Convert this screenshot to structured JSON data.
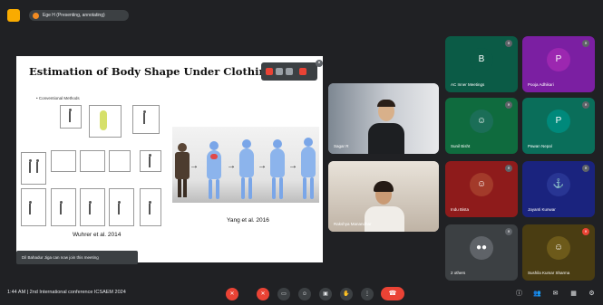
{
  "topbar": {
    "pill_text": "Ege H (Presenting, annotating)"
  },
  "slide": {
    "title": "Estimation of Body Shape Under Clothing",
    "bullet": "•  Conventional Methods",
    "caption_right": "Yang et al. 2016",
    "caption_left": "Wuhrer et al. 2014"
  },
  "toast": {
    "text": "Dil Bahadur Jiga can now join this meeting"
  },
  "participants": [
    {
      "name": "Sagar R",
      "initial": "",
      "color": "#c8ccd2"
    },
    {
      "name": "Rakshya Manandhar",
      "initial": "",
      "color": "#b4a89a"
    }
  ],
  "grid": [
    {
      "name": "AC Inner Meetings",
      "initial": "B",
      "bg": "#0b5b46",
      "avatar": "#0b5b46"
    },
    {
      "name": "Pooja Adhikari",
      "initial": "P",
      "bg": "#7b1fa2",
      "avatar": "#9c27b0"
    },
    {
      "name": "Sunil Bisht",
      "initial": "☺",
      "bg": "#0f6b3e",
      "avatar": "#1b6e57"
    },
    {
      "name": "Pawan Nepal",
      "initial": "P",
      "bg": "#0a6e5a",
      "avatar": "#00897b"
    },
    {
      "name": "Indu Bista",
      "initial": "☺",
      "bg": "#8e1b1b",
      "avatar": "#a33a2a"
    },
    {
      "name": "Jayanti Kunwar",
      "initial": "⚓",
      "bg": "#1a237e",
      "avatar": "#283593"
    },
    {
      "name": "2 others",
      "initial": "●●",
      "bg": "#3c4043",
      "avatar": "#5f6368"
    },
    {
      "name": "Sushila Kumar Sharma",
      "initial": "☺",
      "bg": "#4a3d12",
      "avatar": "#6d5a1a"
    }
  ],
  "bottombar": {
    "clock": "1:44 AM  |  2nd International conference ICSAEM 2024",
    "end_icon": "☎"
  },
  "colors": {
    "background": "#202124",
    "accent_red": "#ea4335"
  }
}
